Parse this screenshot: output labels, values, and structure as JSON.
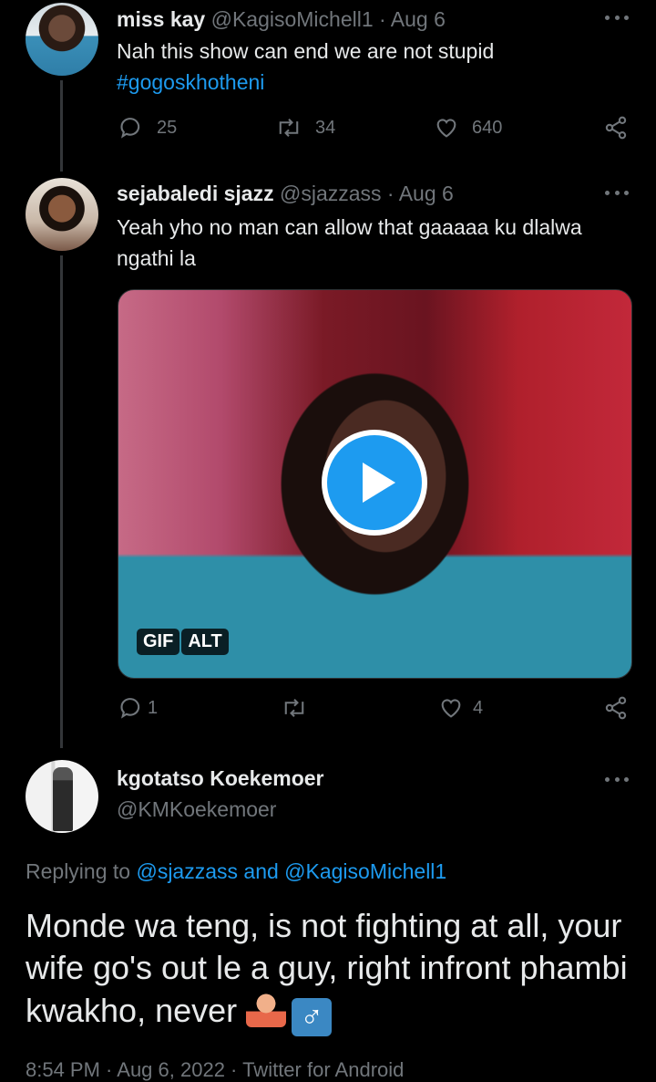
{
  "tweet1": {
    "name": "miss kay",
    "handle_date": "@KagisoMichell1 · Aug 6",
    "text": "Nah this show can end we are not stupid",
    "hashtag": "#gogoskhotheni",
    "replies": "25",
    "retweets": "34",
    "likes": "640"
  },
  "tweet2": {
    "name": "sejabaledi sjazz",
    "handle_date": "@sjazzass · Aug 6",
    "text": "Yeah yho no man can allow that gaaaaa ku dlalwa ngathi la",
    "gif_badge": "GIF",
    "alt_badge": "ALT",
    "replies": "1",
    "likes": "4"
  },
  "tweet3": {
    "name": "kgotatso Koekemoer",
    "handle": "@KMKoekemoer",
    "replying_prefix": "Replying to",
    "replying_to": "@sjazzass and @KagisoMichell1",
    "text": "Monde wa teng, is not fighting at all, your wife go's out le a guy, right infront phambi kwakho, never",
    "emoji_male": "♂",
    "footer": "8:54 PM · Aug 6, 2022 · Twitter for Android"
  },
  "colors": {
    "accent": "#1d9bf0",
    "muted": "#71767b",
    "text": "#e7e9ea",
    "background": "#000000"
  },
  "icons": [
    "reply-icon",
    "retweet-icon",
    "like-icon",
    "share-icon",
    "more-icon",
    "play-icon"
  ]
}
